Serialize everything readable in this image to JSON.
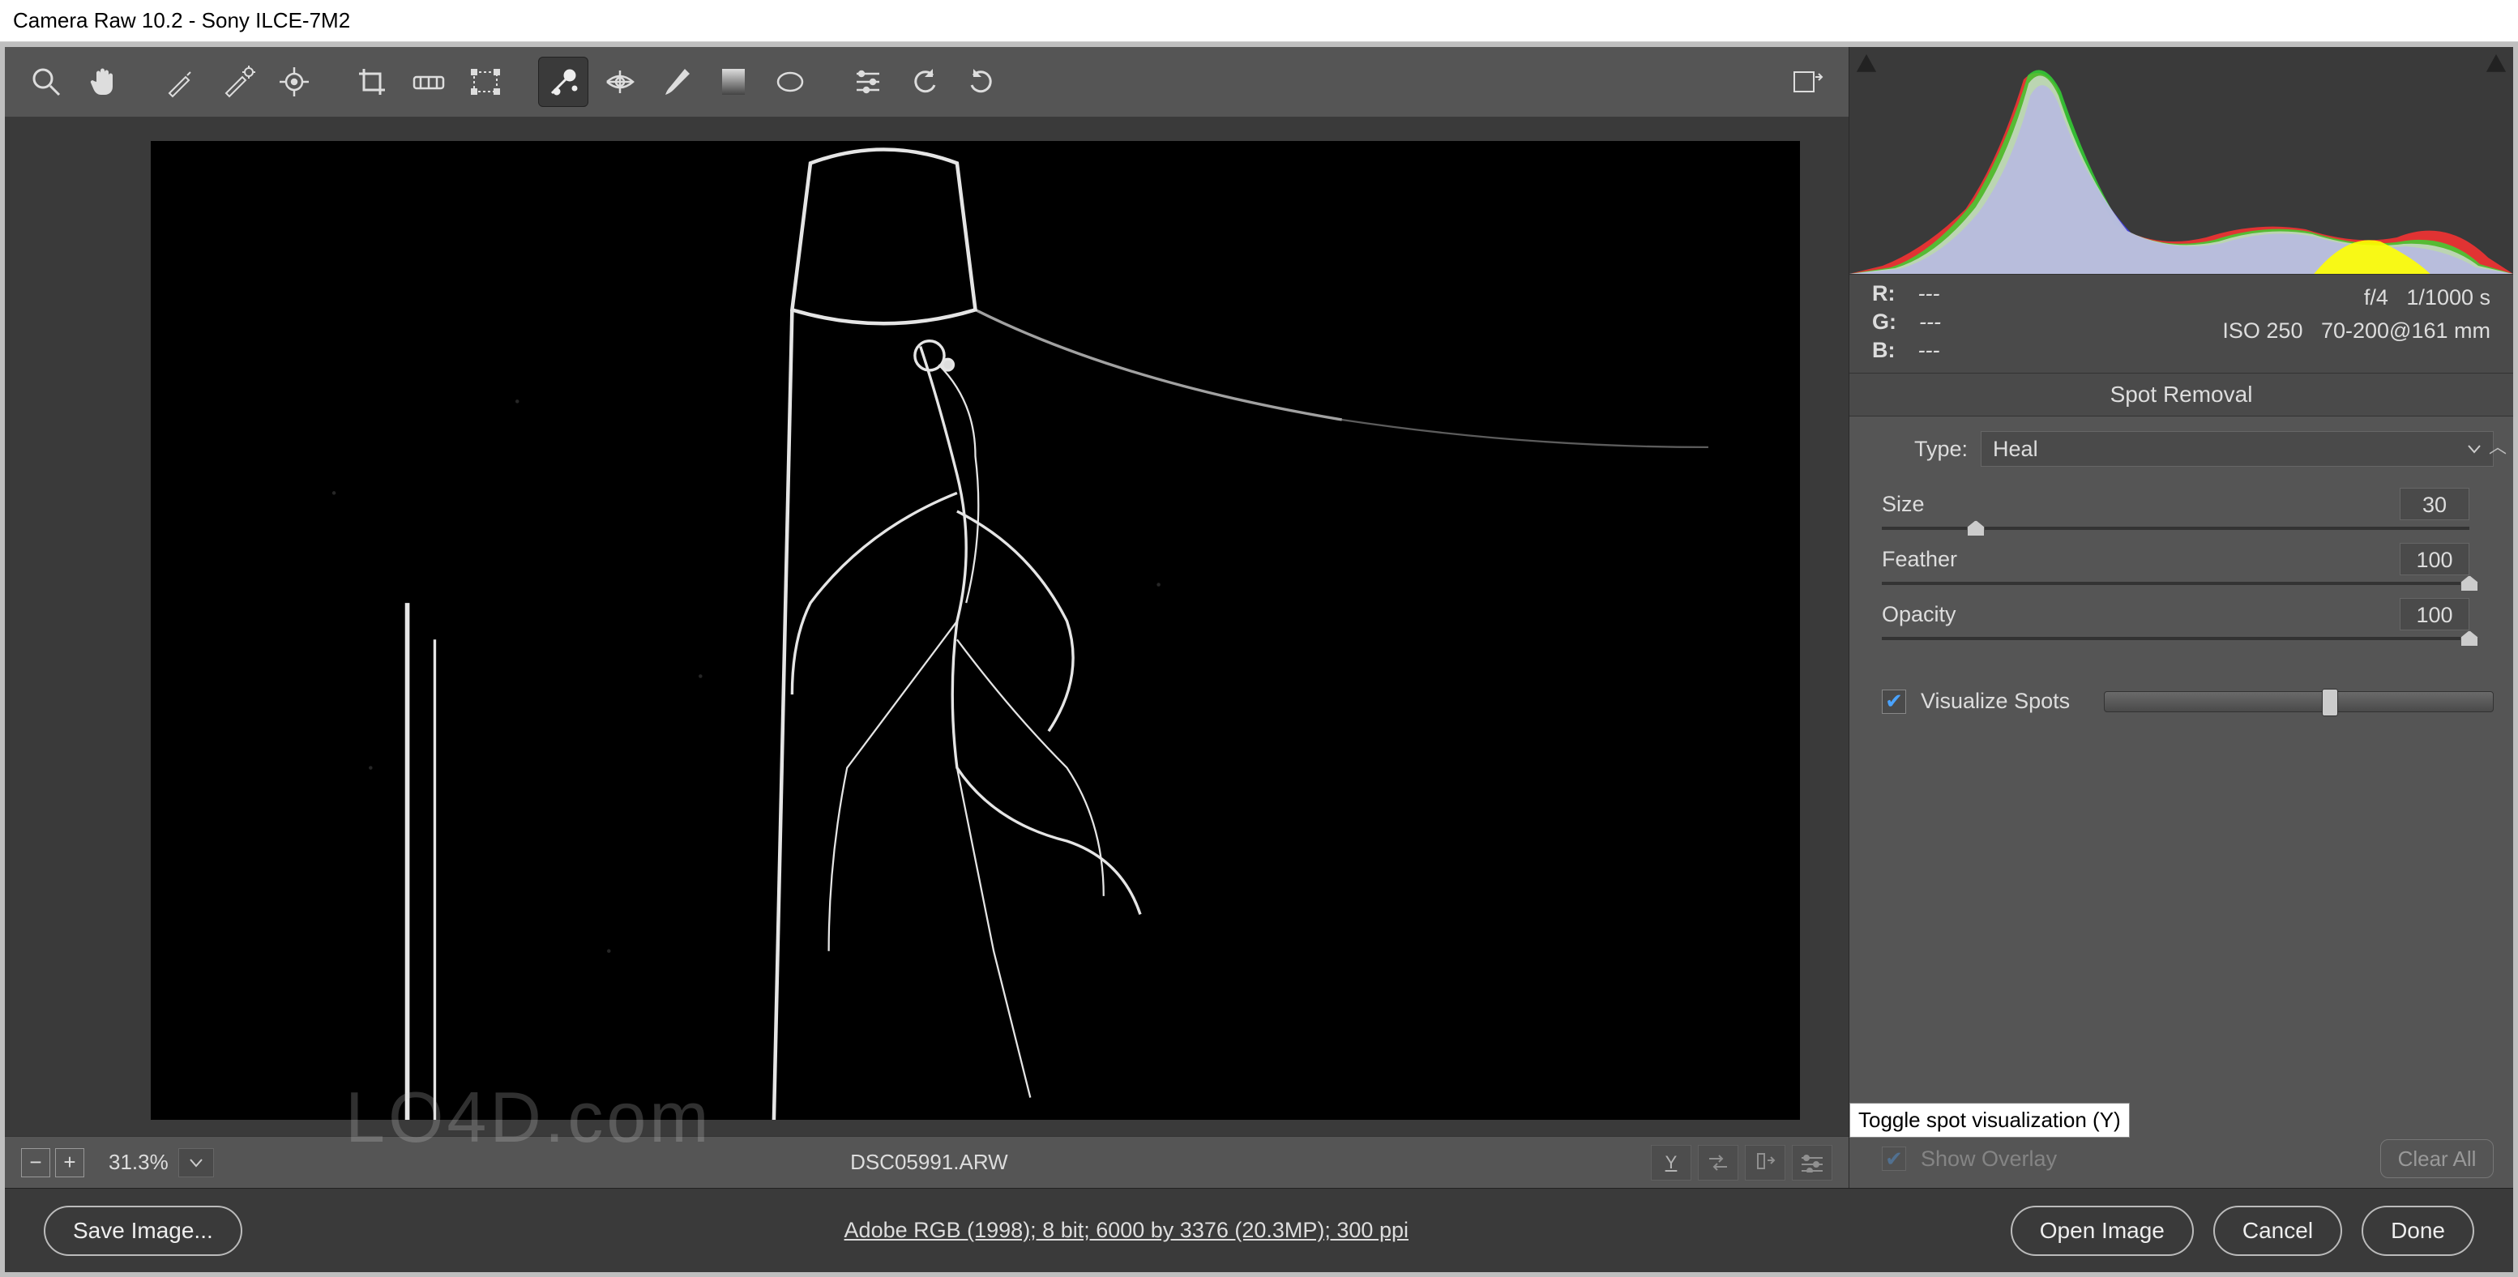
{
  "title": "Camera Raw 10.2  -  Sony ILCE-7M2",
  "toolbar": {
    "tools": [
      {
        "name": "zoom-tool",
        "interactable": true
      },
      {
        "name": "hand-tool",
        "interactable": true
      },
      {
        "name": "gap"
      },
      {
        "name": "white-balance-tool",
        "interactable": true
      },
      {
        "name": "color-sampler-tool",
        "interactable": true
      },
      {
        "name": "targeted-adjustment-tool",
        "interactable": true
      },
      {
        "name": "gap"
      },
      {
        "name": "crop-tool",
        "interactable": true
      },
      {
        "name": "straighten-tool",
        "interactable": true
      },
      {
        "name": "transform-tool",
        "interactable": true
      },
      {
        "name": "gap"
      },
      {
        "name": "spot-removal-tool",
        "active": true,
        "interactable": true
      },
      {
        "name": "red-eye-tool",
        "interactable": true
      },
      {
        "name": "adjustment-brush-tool",
        "interactable": true
      },
      {
        "name": "graduated-filter-tool",
        "interactable": true
      },
      {
        "name": "radial-filter-tool",
        "interactable": true
      },
      {
        "name": "gap"
      },
      {
        "name": "preferences-tool",
        "interactable": true
      },
      {
        "name": "rotate-ccw-tool",
        "interactable": true
      },
      {
        "name": "rotate-cw-tool",
        "interactable": true
      }
    ],
    "fullscreen_name": "toggle-fullscreen"
  },
  "bottombar": {
    "zoom": "31.3%",
    "filename": "DSC05991.ARW",
    "compare_icon": "Y"
  },
  "readout": {
    "r_label": "R:",
    "r_val": "---",
    "g_label": "G:",
    "g_val": "---",
    "b_label": "B:",
    "b_val": "---",
    "aperture": "f/4",
    "shutter": "1/1000 s",
    "iso": "ISO 250",
    "lens": "70-200@161 mm"
  },
  "panel": {
    "title": "Spot Removal",
    "type_label": "Type:",
    "type_value": "Heal",
    "sliders": [
      {
        "label": "Size",
        "value": "30",
        "pos": 16
      },
      {
        "label": "Feather",
        "value": "100",
        "pos": 100
      },
      {
        "label": "Opacity",
        "value": "100",
        "pos": 100
      }
    ],
    "viz_label": "Visualize Spots",
    "overlay_label": "Show Overlay",
    "clear_label": "Clear All",
    "tooltip": "Toggle spot visualization (Y)"
  },
  "footer": {
    "save": "Save Image...",
    "spec": "Adobe RGB (1998); 8 bit; 6000 by 3376 (20.3MP); 300 ppi",
    "open": "Open Image",
    "cancel": "Cancel",
    "done": "Done"
  },
  "watermark": "LO4D.com"
}
